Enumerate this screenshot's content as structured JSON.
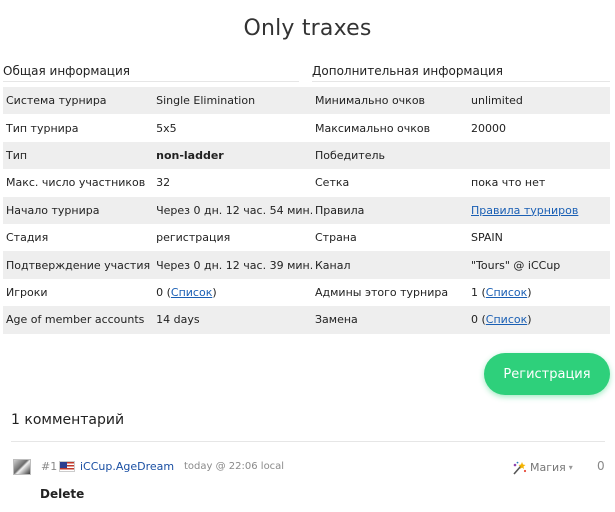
{
  "title": "Only traxes",
  "general": {
    "heading": "Общая информация",
    "rows": [
      {
        "key": "Система турнира",
        "value": "Single Elimination"
      },
      {
        "key": "Тип турнира",
        "value": "5x5"
      },
      {
        "key": "Тип",
        "value": "non-ladder"
      },
      {
        "key": "Макс. число участников",
        "value": "32"
      },
      {
        "key": "Начало турнира",
        "value": "Через 0 дн. 12 час. 54 мин."
      },
      {
        "key": "Стадия",
        "value": "регистрация"
      },
      {
        "key": "Подтверждение участия",
        "value": "Через 0 дн. 12 час. 39 мин."
      },
      {
        "key": "Игроки",
        "value": "0 (",
        "link": "Список",
        "suffix": ")"
      },
      {
        "key": "Age of member accounts",
        "value": "14 days"
      }
    ]
  },
  "extra": {
    "heading": "Дополнительная информация",
    "rows": [
      {
        "key": "Минимально очков",
        "value": "unlimited"
      },
      {
        "key": "Максимально очков",
        "value": "20000"
      },
      {
        "key": "Победитель",
        "value": ""
      },
      {
        "key": "Сетка",
        "value": "пока что нет"
      },
      {
        "key": "Правила",
        "value": "",
        "link": "Правила турниров",
        "suffix": ""
      },
      {
        "key": "Страна",
        "value": "SPAIN"
      },
      {
        "key": "Канал",
        "value": "\"Tours\" @ iCCup"
      },
      {
        "key": "Админы этого турнира",
        "value": "1 (",
        "link": "Список",
        "suffix": ")"
      },
      {
        "key": "Замена",
        "value": "0 (",
        "link": "Список",
        "suffix": ")"
      }
    ]
  },
  "register_button": "Регистрация",
  "comments": {
    "title": "1 комментарий",
    "items": [
      {
        "number": "#1",
        "author": "iCCup.AgeDream",
        "time": "today @ 22:06 local",
        "magic_label": "Магия",
        "magic_caret": "▾",
        "score": "0",
        "delete_label": "Delete"
      }
    ]
  },
  "icons": {
    "avatar": "user-avatar",
    "flag": "usa-flag-icon",
    "magic": "magic-wand-icon"
  }
}
